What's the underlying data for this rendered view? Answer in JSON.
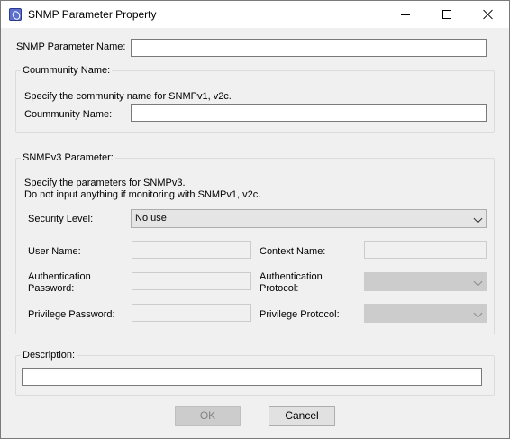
{
  "window": {
    "title": "SNMP Parameter Property",
    "app_icon": "snmp-app-icon",
    "controls": {
      "minimize": "minimize-icon",
      "maximize": "maximize-icon",
      "close": "close-icon"
    }
  },
  "form": {
    "param_name_label": "SNMP Parameter Name:",
    "param_name_value": ""
  },
  "community": {
    "group_title": "Coummunity Name:",
    "hint": "Specify the community name for SNMPv1, v2c.",
    "name_label": "Coummunity Name:",
    "name_value": ""
  },
  "snmpv3": {
    "group_title": "SNMPv3 Parameter:",
    "hint_line1": "Specify the parameters for SNMPv3.",
    "hint_line2": "Do not input anything if monitoring with SNMPv1, v2c.",
    "security_level_label": "Security Level:",
    "security_level_value": "No use",
    "user_name_label": "User Name:",
    "user_name_value": "",
    "context_name_label": "Context Name:",
    "context_name_value": "",
    "auth_password_label_1": "Authentication",
    "auth_password_label_2": "Password:",
    "auth_password_value": "",
    "auth_protocol_label_1": "Authentication",
    "auth_protocol_label_2": "Protocol:",
    "auth_protocol_value": "",
    "priv_password_label": "Privilege Password:",
    "priv_password_value": "",
    "priv_protocol_label": "Privilege Protocol:",
    "priv_protocol_value": ""
  },
  "description": {
    "group_title": "Description:",
    "value": ""
  },
  "buttons": {
    "ok": "OK",
    "cancel": "Cancel"
  }
}
